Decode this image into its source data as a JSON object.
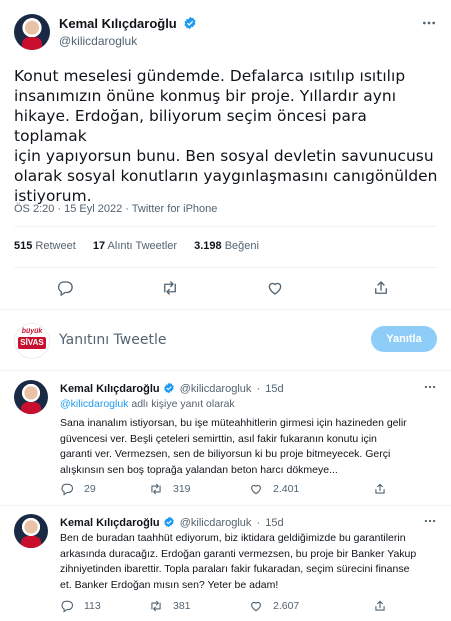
{
  "main_tweet": {
    "author_name": "Kemal Kılıçdaroğlu",
    "author_handle": "@kilicdarogluk",
    "text": "Konut meselesi gündemde. Defalarca ısıtılıp ısıtılıp\ninsanımızın önüne konmuş bir proje. Yıllardır aynı\nhikaye. Erdoğan, biliyorum seçim öncesi para toplamak\niçin yapıyorsun bunu. Ben sosyal devletin savunucusu\nolarak sosyal konutların yaygınlaşmasını canıgönülden\nistiyorum.",
    "meta": "ÖS 2:20 · 15 Eyl 2022 · Twitter for iPhone",
    "stats": {
      "retweets_count": "515",
      "retweets_label": "Retweet",
      "quotes_count": "17",
      "quotes_label": "Alıntı Tweetler",
      "likes_count": "3.198",
      "likes_label": "Beğeni"
    },
    "actions": [
      "reply-icon",
      "retweet-icon",
      "like-icon",
      "share-icon"
    ]
  },
  "composer": {
    "avatar_brand_top": "büyük",
    "avatar_brand_main": "SİVAS",
    "placeholder": "Yanıtını Tweetle",
    "button_label": "Yanıtla"
  },
  "replies": [
    {
      "author_name": "Kemal Kılıçdaroğlu",
      "author_handle": "@kilicdarogluk",
      "time": "15d",
      "replying_prefix": "",
      "replying_handle": "@kilicdarogluk",
      "replying_suffix": " adlı kişiye yanıt olarak",
      "text": "Sana inanalım istiyorsan, bu işe müteahhitlerin girmesi için hazineden gelir\ngüvencesi ver. Beşli çeteleri semirttin, asıl fakir fukaranın konutu için\ngaranti ver. Vermezsen, sen de biliyorsun ki bu proje bitmeyecek. Gerçi\nalışkınsın sen boş toprağa yalandan beton harcı dökmeye...",
      "replies_count": "29",
      "retweets_count": "319",
      "likes_count": "2.401"
    },
    {
      "author_name": "Kemal Kılıçdaroğlu",
      "author_handle": "@kilicdarogluk",
      "time": "15d",
      "text": "Ben de buradan taahhüt ediyorum, biz iktidara geldiğimizde bu garantilerin\narkasında duracağız. Erdoğan garanti vermezsen, bu proje bir Banker Yakup\nzihniyetinden ibarettir. Topla paraları fakir fukaradan, seçim sürecini finanse\net. Banker Erdoğan mısın sen? Yeter be adam!",
      "replies_count": "113",
      "retweets_count": "381",
      "likes_count": "2.607"
    }
  ],
  "colors": {
    "accent": "#1d9bf0",
    "text": "#0f1419",
    "secondary": "#536471",
    "reply_button": "#8ecdf8",
    "divider": "#eff3f4"
  }
}
